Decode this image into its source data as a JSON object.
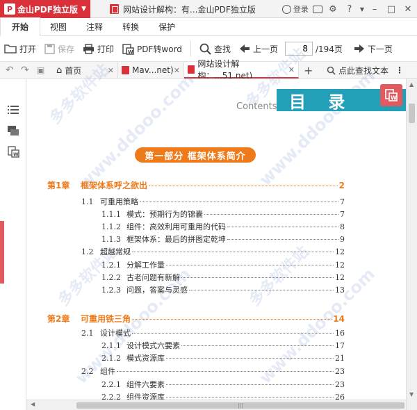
{
  "app": {
    "name": "金山PDF独立版",
    "logo": "P"
  },
  "title": {
    "doc_title": "网站设计解构：有...金山PDF独立版",
    "login": "登录"
  },
  "menu": [
    "开始",
    "视图",
    "注释",
    "转换",
    "保护"
  ],
  "toolbar": {
    "open": "打开",
    "save": "保存",
    "print": "打印",
    "pdf2word": "PDF转word",
    "find": "查找",
    "prev": "上一页",
    "page": "8",
    "total": "/194页",
    "next": "下一页"
  },
  "tabs": {
    "home": "首页",
    "tab1": "Mav...net)",
    "tab2": "网站设计解构：...51.net)",
    "findtext": "点此查找文本"
  },
  "doc": {
    "contents": "Contents",
    "heading": "目 录",
    "part": "第一部分  框架体系简介",
    "ch1": {
      "num": "第1章",
      "title": "框架体系呼之欲出",
      "page": "2"
    },
    "s11": {
      "num": "1.1",
      "title": "可重用策略",
      "page": "7"
    },
    "s111": {
      "num": "1.1.1",
      "title": "模式：预期行为的锦囊",
      "page": "7"
    },
    "s112": {
      "num": "1.1.2",
      "title": "组件：高效利用可重用的代码",
      "page": "8"
    },
    "s113": {
      "num": "1.1.3",
      "title": "框架体系：最后的拼图定乾坤",
      "page": "9"
    },
    "s12": {
      "num": "1.2",
      "title": "超越常规",
      "page": "12"
    },
    "s121": {
      "num": "1.2.1",
      "title": "分解工作量",
      "page": "12"
    },
    "s122": {
      "num": "1.2.2",
      "title": "古老问题有新解",
      "page": "12"
    },
    "s123": {
      "num": "1.2.3",
      "title": "问题，答案与灵感",
      "page": "13"
    },
    "ch2": {
      "num": "第2章",
      "title": "可重用铁三角",
      "page": "14"
    },
    "s21": {
      "num": "2.1",
      "title": "设计模式",
      "page": "16"
    },
    "s211": {
      "num": "2.1.1",
      "title": "设计模式六要素",
      "page": "17"
    },
    "s212": {
      "num": "2.1.2",
      "title": "模式资源库",
      "page": "21"
    },
    "s22": {
      "num": "2.2",
      "title": "组件",
      "page": "23"
    },
    "s221": {
      "num": "2.2.1",
      "title": "组件六要素",
      "page": "23"
    },
    "s222": {
      "num": "2.2.2",
      "title": "组件资源库",
      "page": "26"
    }
  },
  "watermark": [
    "多多软件站",
    "www.ddooo.com"
  ],
  "colors": {
    "brand": "#d9303a",
    "accent_orange": "#ef7a1a",
    "teal": "#23a0b8"
  }
}
